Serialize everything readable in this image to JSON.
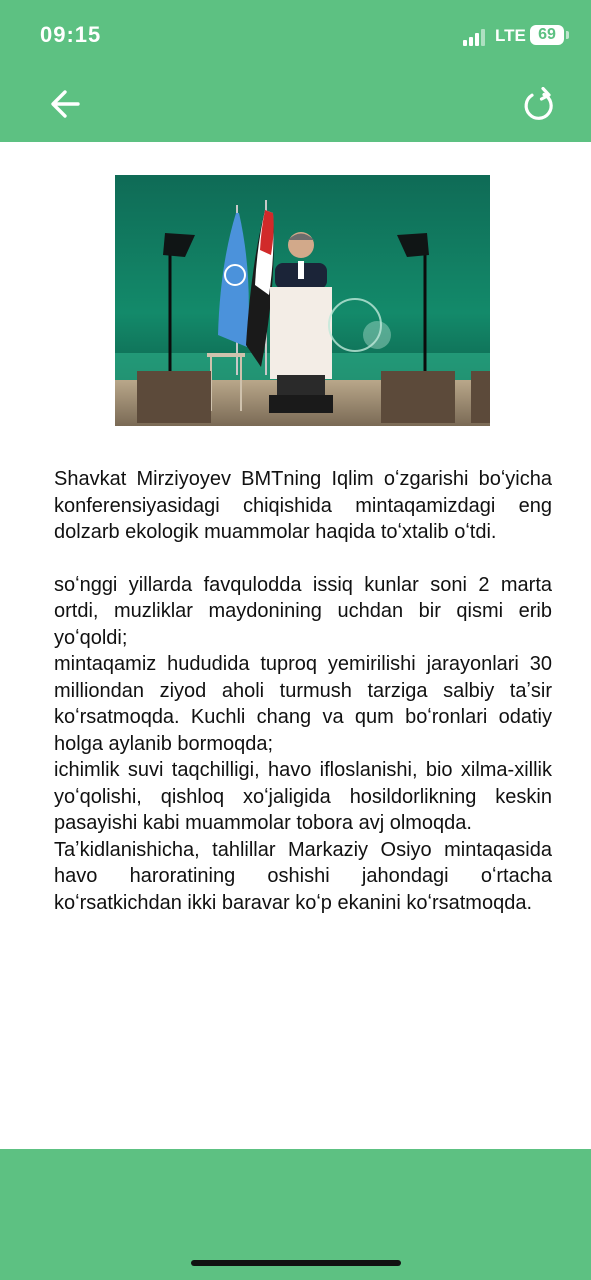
{
  "status_bar": {
    "time": "09:15",
    "network": "LTE",
    "battery": "69"
  },
  "toolbar": {
    "back_icon": "arrow-left-icon",
    "refresh_icon": "refresh-icon"
  },
  "theme": {
    "primary": "#5dc182",
    "text": "#111111",
    "background": "#ffffff"
  },
  "article": {
    "lead": "Shavkat Mirziyoyev BMTning Iqlim oʻzgarishi boʻyicha konferensiyasidagi chiqishida mintaqamizdagi eng dolzarb ekologik muammolar haqida toʻxtalib oʻtdi.",
    "paragraphs": [
      "soʻnggi yillarda favqulodda issiq kunlar soni 2 marta ortdi, muzliklar maydonining uchdan bir qismi erib yoʻqoldi;",
      "mintaqamiz hududida tuproq yemirilishi jarayonlari 30 milliondan ziyod aholi turmush tarziga salbiy taʼsir koʻrsatmoqda. Kuchli chang va qum boʻronlari odatiy holga aylanib bormoqda;",
      "ichimlik suvi taqchilligi, havo ifloslanishi, bio xilma-xillik yoʻqolishi, qishloq xoʻjaligida hosildorlikning keskin pasayishi kabi muammolar tobora avj olmoqda.",
      "Taʼkidlanishicha, tahlillar Markaziy Osiyo mintaqasida havo haroratining oshishi jahondagi oʻrtacha koʻrsatkichdan ikki baravar koʻp ekanini koʻrsatmoqda."
    ]
  }
}
